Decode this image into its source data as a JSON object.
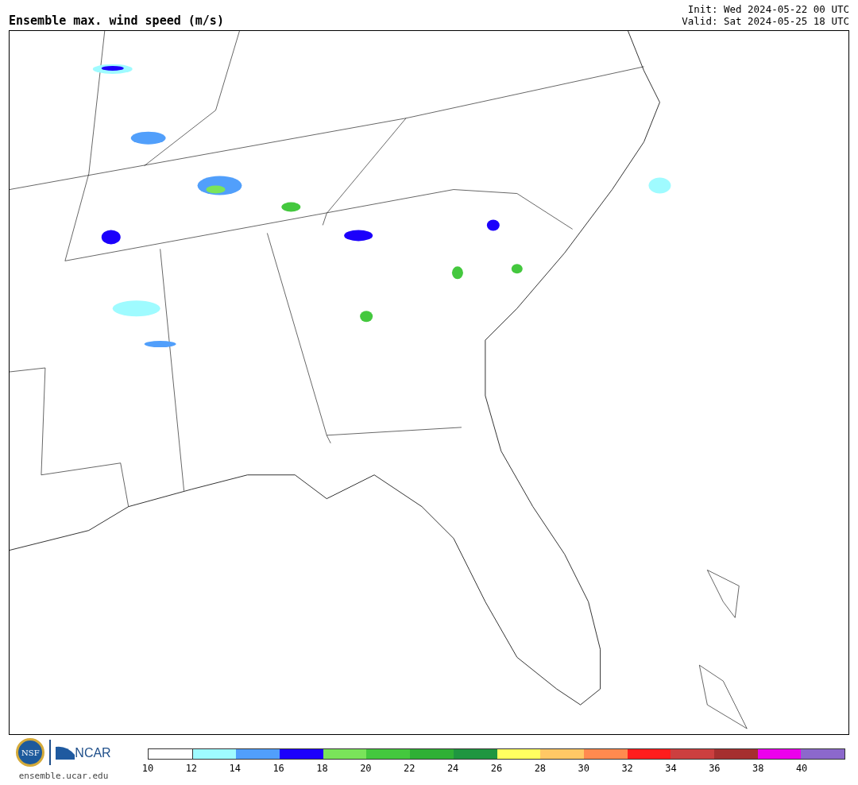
{
  "title": "Ensemble max. wind speed (m/s)",
  "init": "Init: Wed 2024-05-22 00 UTC",
  "valid": "Valid: Sat 2024-05-25 18 UTC",
  "logos": {
    "nsf": "NSF",
    "ncar": "NCAR",
    "url": "ensemble.ucar.edu"
  },
  "colorbar": {
    "bins": [
      {
        "color": "#ffffff"
      },
      {
        "color": "#9ffbff"
      },
      {
        "color": "#519ffb"
      },
      {
        "color": "#1c00fb"
      },
      {
        "color": "#7ae45a"
      },
      {
        "color": "#44c83e"
      },
      {
        "color": "#2fb035"
      },
      {
        "color": "#1f9640"
      },
      {
        "color": "#ffff60"
      },
      {
        "color": "#ffc865"
      },
      {
        "color": "#ff8a4f"
      },
      {
        "color": "#ff1d1d"
      },
      {
        "color": "#cc3f3f"
      },
      {
        "color": "#a52f2f"
      },
      {
        "color": "#ec00ec"
      },
      {
        "color": "#8c68cc"
      }
    ],
    "ticks": [
      "10",
      "12",
      "14",
      "16",
      "18",
      "20",
      "22",
      "24",
      "26",
      "28",
      "30",
      "32",
      "34",
      "36",
      "38",
      "40"
    ]
  }
}
